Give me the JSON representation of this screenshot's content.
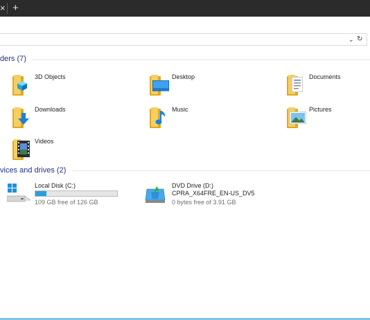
{
  "titlebar": {
    "close_glyph": "×",
    "new_tab_glyph": "+"
  },
  "address": {
    "dropdown_glyph": "⌄",
    "refresh_glyph": "↻"
  },
  "folders_group": {
    "label": "ders (7)"
  },
  "folders": [
    {
      "label": "3D Objects",
      "icon": "3d-objects-icon"
    },
    {
      "label": "Desktop",
      "icon": "desktop-icon"
    },
    {
      "label": "Documents",
      "icon": "documents-icon"
    },
    {
      "label": "Downloads",
      "icon": "downloads-icon"
    },
    {
      "label": "Music",
      "icon": "music-icon"
    },
    {
      "label": "Pictures",
      "icon": "pictures-icon"
    },
    {
      "label": "Videos",
      "icon": "videos-icon"
    }
  ],
  "drives_group": {
    "label": "vices and drives (2)"
  },
  "drives": [
    {
      "name": "Local Disk (C:)",
      "free": "109 GB free of 126 GB",
      "used_fraction": 0.135,
      "icon": "local-disk-icon"
    },
    {
      "name": "DVD Drive (D:)",
      "volume": "CPRA_X64FRE_EN-US_DV5",
      "free": "0 bytes free of 3.91 GB",
      "icon": "dvd-drive-icon"
    }
  ],
  "colors": {
    "accent": "#26a0da",
    "group_header": "#1e3287",
    "folder": "#f5cf63",
    "titlebar": "#2b2b2b"
  }
}
